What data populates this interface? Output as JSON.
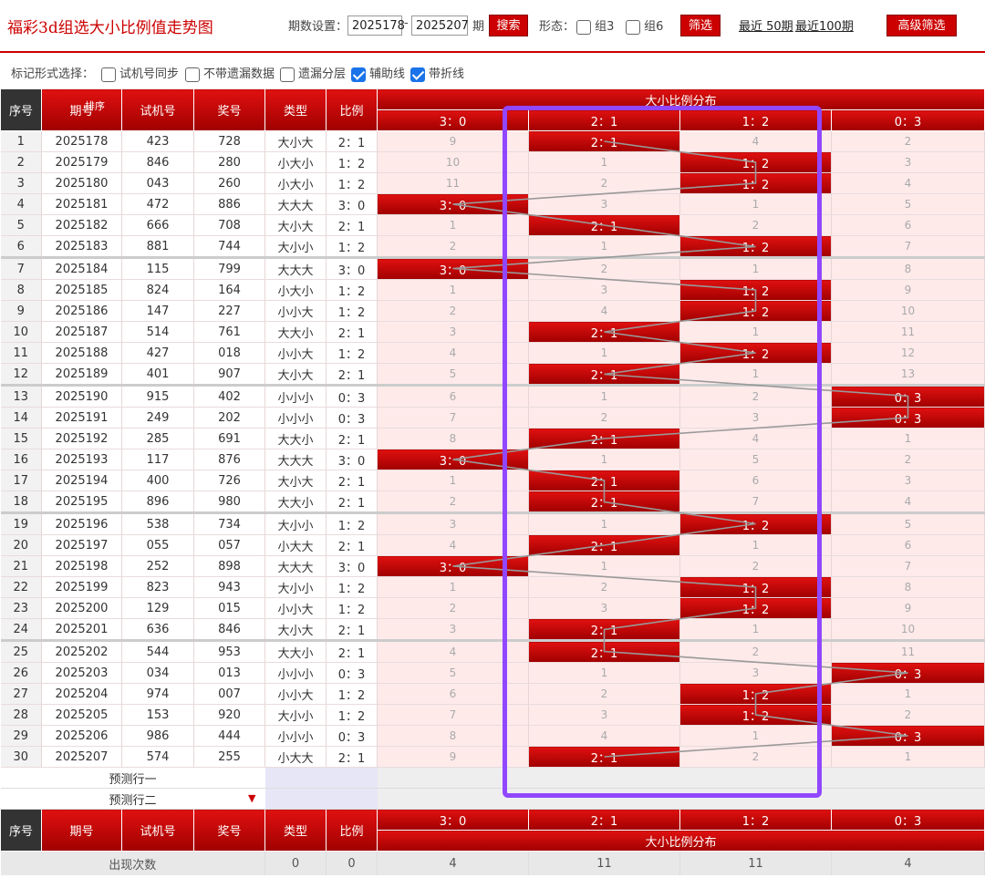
{
  "header": {
    "title": "福彩3d组选大小比例值走势图",
    "period_label": "期数设置：",
    "from": "2025178",
    "dash": "-",
    "to": "2025207",
    "period_unit": "期",
    "search": "搜索",
    "form_label": "形态：",
    "g3": "组3",
    "g6": "组6",
    "filter": "筛选",
    "recent50": "最近 50期",
    "recent100": "最近100期",
    "advanced": "高级筛选"
  },
  "options": {
    "label": "标记形式选择：",
    "o1": "试机号同步",
    "o2": "不带遗漏数据",
    "o3": "遗漏分层",
    "o4": "辅助线",
    "o5": "带折线"
  },
  "table": {
    "h_idx": "序号",
    "h_issue": "期号",
    "h_sort": "排序",
    "h_test": "试机号",
    "h_prize": "奖号",
    "h_type": "类型",
    "h_ratio": "比例",
    "h_dist": "大小比例分布",
    "dist_cols": [
      "3：0",
      "2：1",
      "1：2",
      "0：3"
    ],
    "rows": [
      {
        "idx": "1",
        "issue": "2025178",
        "test": "423",
        "prize": "728",
        "type": "大小大",
        "ratio": "2：1",
        "d": [
          "9",
          "2：1",
          "4",
          "2"
        ],
        "hit": 1
      },
      {
        "idx": "2",
        "issue": "2025179",
        "test": "846",
        "prize": "280",
        "type": "小大小",
        "ratio": "1：2",
        "d": [
          "10",
          "1",
          "1：2",
          "3"
        ],
        "hit": 2
      },
      {
        "idx": "3",
        "issue": "2025180",
        "test": "043",
        "prize": "260",
        "type": "小大小",
        "ratio": "1：2",
        "d": [
          "11",
          "2",
          "1：2",
          "4"
        ],
        "hit": 2
      },
      {
        "idx": "4",
        "issue": "2025181",
        "test": "472",
        "prize": "886",
        "type": "大大大",
        "ratio": "3：0",
        "d": [
          "3：0",
          "3",
          "1",
          "5"
        ],
        "hit": 0
      },
      {
        "idx": "5",
        "issue": "2025182",
        "test": "666",
        "prize": "708",
        "type": "大小大",
        "ratio": "2：1",
        "d": [
          "1",
          "2：1",
          "2",
          "6"
        ],
        "hit": 1
      },
      {
        "idx": "6",
        "issue": "2025183",
        "test": "881",
        "prize": "744",
        "type": "大小小",
        "ratio": "1：2",
        "d": [
          "2",
          "1",
          "1：2",
          "7"
        ],
        "hit": 2
      },
      {
        "idx": "7",
        "issue": "2025184",
        "test": "115",
        "prize": "799",
        "type": "大大大",
        "ratio": "3：0",
        "d": [
          "3：0",
          "2",
          "1",
          "8"
        ],
        "hit": 0
      },
      {
        "idx": "8",
        "issue": "2025185",
        "test": "824",
        "prize": "164",
        "type": "小大小",
        "ratio": "1：2",
        "d": [
          "1",
          "3",
          "1：2",
          "9"
        ],
        "hit": 2
      },
      {
        "idx": "9",
        "issue": "2025186",
        "test": "147",
        "prize": "227",
        "type": "小小大",
        "ratio": "1：2",
        "d": [
          "2",
          "4",
          "1：2",
          "10"
        ],
        "hit": 2
      },
      {
        "idx": "10",
        "issue": "2025187",
        "test": "514",
        "prize": "761",
        "type": "大大小",
        "ratio": "2：1",
        "d": [
          "3",
          "2：1",
          "1",
          "11"
        ],
        "hit": 1
      },
      {
        "idx": "11",
        "issue": "2025188",
        "test": "427",
        "prize": "018",
        "type": "小小大",
        "ratio": "1：2",
        "d": [
          "4",
          "1",
          "1：2",
          "12"
        ],
        "hit": 2
      },
      {
        "idx": "12",
        "issue": "2025189",
        "test": "401",
        "prize": "907",
        "type": "大小大",
        "ratio": "2：1",
        "d": [
          "5",
          "2：1",
          "1",
          "13"
        ],
        "hit": 1
      },
      {
        "idx": "13",
        "issue": "2025190",
        "test": "915",
        "prize": "402",
        "type": "小小小",
        "ratio": "0：3",
        "d": [
          "6",
          "1",
          "2",
          "0：3"
        ],
        "hit": 3
      },
      {
        "idx": "14",
        "issue": "2025191",
        "test": "249",
        "prize": "202",
        "type": "小小小",
        "ratio": "0：3",
        "d": [
          "7",
          "2",
          "3",
          "0：3"
        ],
        "hit": 3
      },
      {
        "idx": "15",
        "issue": "2025192",
        "test": "285",
        "prize": "691",
        "type": "大大小",
        "ratio": "2：1",
        "d": [
          "8",
          "2：1",
          "4",
          "1"
        ],
        "hit": 1
      },
      {
        "idx": "16",
        "issue": "2025193",
        "test": "117",
        "prize": "876",
        "type": "大大大",
        "ratio": "3：0",
        "d": [
          "3：0",
          "1",
          "5",
          "2"
        ],
        "hit": 0
      },
      {
        "idx": "17",
        "issue": "2025194",
        "test": "400",
        "prize": "726",
        "type": "大小大",
        "ratio": "2：1",
        "d": [
          "1",
          "2：1",
          "6",
          "3"
        ],
        "hit": 1
      },
      {
        "idx": "18",
        "issue": "2025195",
        "test": "896",
        "prize": "980",
        "type": "大大小",
        "ratio": "2：1",
        "d": [
          "2",
          "2：1",
          "7",
          "4"
        ],
        "hit": 1
      },
      {
        "idx": "19",
        "issue": "2025196",
        "test": "538",
        "prize": "734",
        "type": "大小小",
        "ratio": "1：2",
        "d": [
          "3",
          "1",
          "1：2",
          "5"
        ],
        "hit": 2
      },
      {
        "idx": "20",
        "issue": "2025197",
        "test": "055",
        "prize": "057",
        "type": "小大大",
        "ratio": "2：1",
        "d": [
          "4",
          "2：1",
          "1",
          "6"
        ],
        "hit": 1
      },
      {
        "idx": "21",
        "issue": "2025198",
        "test": "252",
        "prize": "898",
        "type": "大大大",
        "ratio": "3：0",
        "d": [
          "3：0",
          "1",
          "2",
          "7"
        ],
        "hit": 0
      },
      {
        "idx": "22",
        "issue": "2025199",
        "test": "823",
        "prize": "943",
        "type": "大小小",
        "ratio": "1：2",
        "d": [
          "1",
          "2",
          "1：2",
          "8"
        ],
        "hit": 2
      },
      {
        "idx": "23",
        "issue": "2025200",
        "test": "129",
        "prize": "015",
        "type": "小小大",
        "ratio": "1：2",
        "d": [
          "2",
          "3",
          "1：2",
          "9"
        ],
        "hit": 2
      },
      {
        "idx": "24",
        "issue": "2025201",
        "test": "636",
        "prize": "846",
        "type": "大小大",
        "ratio": "2：1",
        "d": [
          "3",
          "2：1",
          "1",
          "10"
        ],
        "hit": 1
      },
      {
        "idx": "25",
        "issue": "2025202",
        "test": "544",
        "prize": "953",
        "type": "大大小",
        "ratio": "2：1",
        "d": [
          "4",
          "2：1",
          "2",
          "11"
        ],
        "hit": 1
      },
      {
        "idx": "26",
        "issue": "2025203",
        "test": "034",
        "prize": "013",
        "type": "小小小",
        "ratio": "0：3",
        "d": [
          "5",
          "1",
          "3",
          "0：3"
        ],
        "hit": 3
      },
      {
        "idx": "27",
        "issue": "2025204",
        "test": "974",
        "prize": "007",
        "type": "小小大",
        "ratio": "1：2",
        "d": [
          "6",
          "2",
          "1：2",
          "1"
        ],
        "hit": 2
      },
      {
        "idx": "28",
        "issue": "2025205",
        "test": "153",
        "prize": "920",
        "type": "大小小",
        "ratio": "1：2",
        "d": [
          "7",
          "3",
          "1：2",
          "2"
        ],
        "hit": 2
      },
      {
        "idx": "29",
        "issue": "2025206",
        "test": "986",
        "prize": "444",
        "type": "小小小",
        "ratio": "0：3",
        "d": [
          "8",
          "4",
          "1",
          "0：3"
        ],
        "hit": 3
      },
      {
        "idx": "30",
        "issue": "2025207",
        "test": "574",
        "prize": "255",
        "type": "小大大",
        "ratio": "2：1",
        "d": [
          "9",
          "2：1",
          "2",
          "1"
        ],
        "hit": 1
      }
    ],
    "predict1": "预测行一",
    "predict2": "预测行二",
    "count_label": "出现次数",
    "count_type": "0",
    "count_ratio": "0",
    "counts": [
      "4",
      "11",
      "11",
      "4"
    ]
  }
}
